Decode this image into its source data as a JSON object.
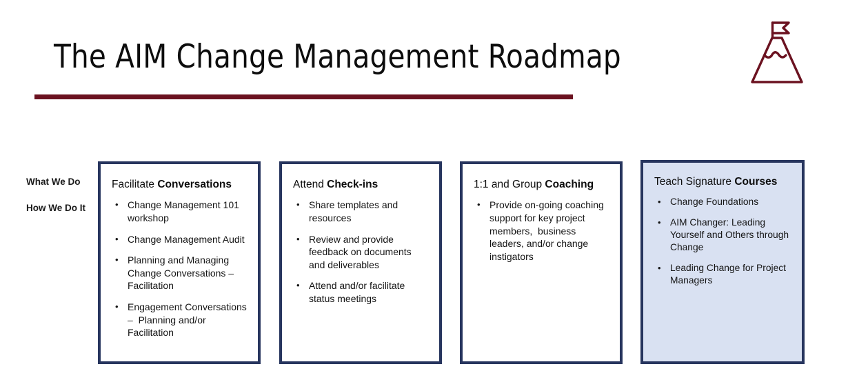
{
  "slide": {
    "title": "The AIM Change Management Roadmap",
    "accent_maroon": "#6b1220",
    "accent_navy": "#27355e",
    "highlight_fill": "#d9e1f2",
    "background": "#ffffff"
  },
  "logo": {
    "name": "mountain-flag-icon",
    "color": "#6b1220"
  },
  "row_labels": {
    "first": "What We Do",
    "second": "How We Do It"
  },
  "cards": [
    {
      "header_regular": "Facilitate ",
      "header_bold": "Conversations",
      "highlighted": false,
      "bullets": [
        "Change Management 101 workshop",
        "Change Management Audit",
        "Planning and Managing Change Conversations – Facilitation",
        "Engagement Conversations –  Planning and/or Facilitation"
      ]
    },
    {
      "header_regular": "Attend ",
      "header_bold": "Check-ins",
      "highlighted": false,
      "bullets": [
        "Share templates and resources",
        "Review and provide feedback on documents and deliverables",
        "Attend and/or facilitate status meetings"
      ]
    },
    {
      "header_regular": "1:1 and Group ",
      "header_bold": "Coaching",
      "highlighted": false,
      "bullets": [
        "Provide on-going coaching support for key project members,  business leaders, and/or change instigators"
      ]
    },
    {
      "header_regular": "Teach Signature ",
      "header_bold": "Courses",
      "highlighted": true,
      "bullets": [
        "Change Foundations",
        "AIM Changer: Leading Yourself and Others through Change",
        "Leading Change for Project Managers"
      ]
    }
  ]
}
